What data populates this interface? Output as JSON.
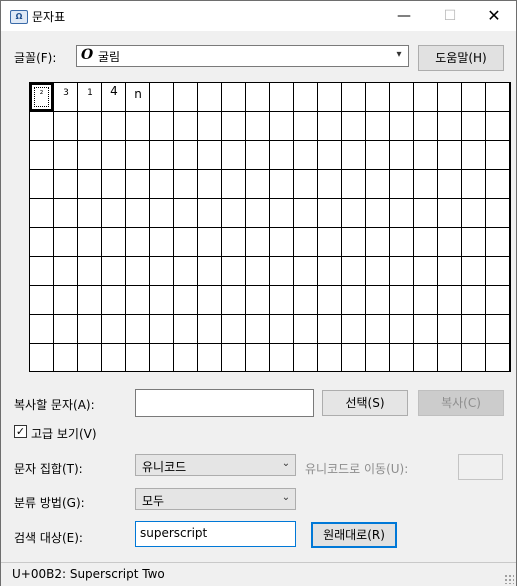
{
  "window": {
    "title": "문자표",
    "icon": "charmap-app-icon",
    "controls": {
      "minimize": "—",
      "maximize": "☐",
      "close": "✕"
    }
  },
  "font_row": {
    "label": "글꼴(F):",
    "font_value": "굴림",
    "font_glyph": "O",
    "help_button": "도움말(H)"
  },
  "grid": {
    "selected_index": 0,
    "characters": [
      "²",
      "3",
      "1",
      "4",
      "n"
    ]
  },
  "copy_row": {
    "label": "복사할 문자(A):",
    "value": "",
    "select_button": "선택(S)",
    "copy_button": "복사(C)"
  },
  "advanced": {
    "checkbox_label": "고급 보기(V)",
    "checked": true
  },
  "charset_row": {
    "label": "문자 집합(T):",
    "value": "유니코드",
    "goto_label": "유니코드로 이동(U):",
    "goto_value": ""
  },
  "group_row": {
    "label": "분류 방법(G):",
    "value": "모두"
  },
  "search_row": {
    "label": "검색 대상(E):",
    "value": "superscript",
    "reset_button": "원래대로(R)"
  },
  "status": {
    "text": "U+00B2: Superscript Two"
  },
  "colors": {
    "focus_accent": "#0078d7",
    "window_bg": "#f0f0f0"
  }
}
